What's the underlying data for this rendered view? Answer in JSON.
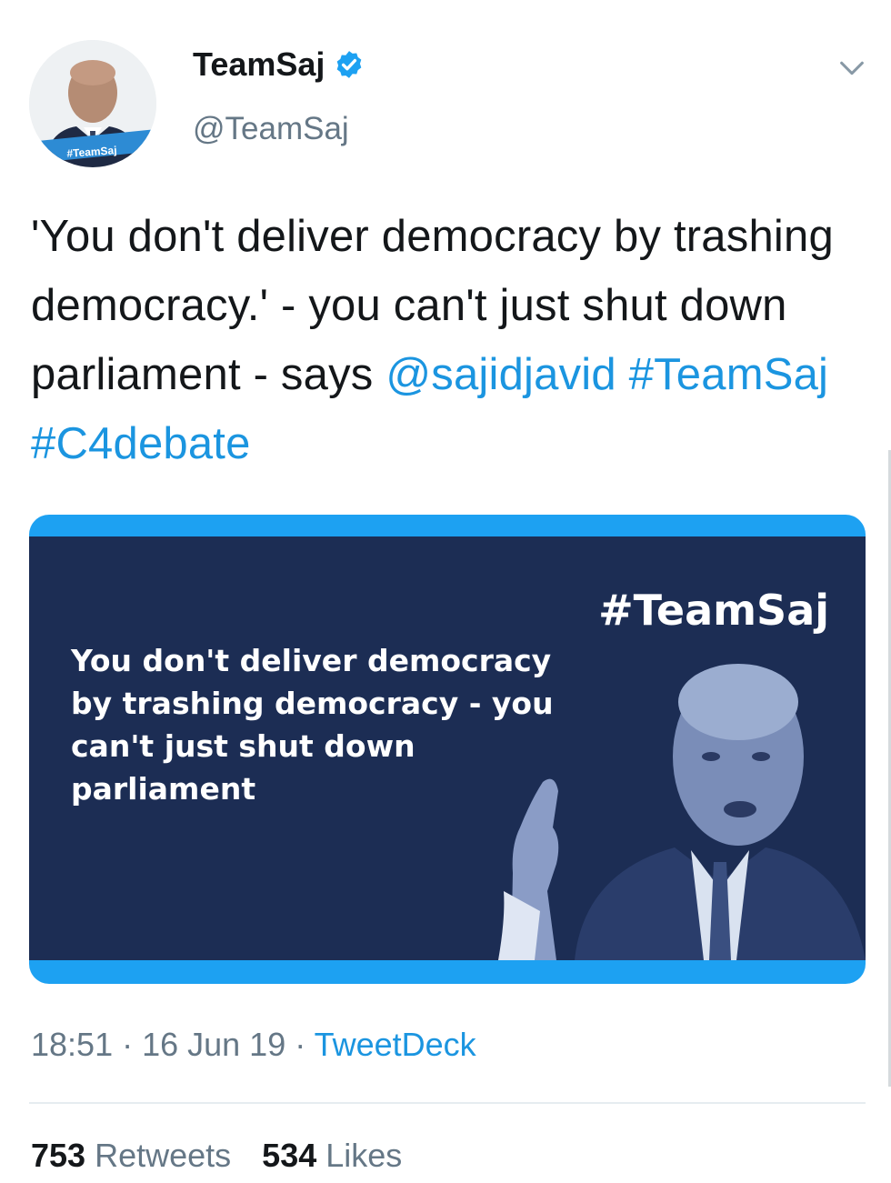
{
  "author": {
    "display_name": "TeamSaj",
    "handle": "@TeamSaj",
    "avatar_tag": "#TeamSaj",
    "verified": true
  },
  "tweet": {
    "text_plain": "'You don't deliver democracy by trashing democracy.' - you can't just shut down parliament - says",
    "mention": "@sajidjavid",
    "hashtag_1": "#TeamSaj",
    "hashtag_2": "#C4debate"
  },
  "media": {
    "hashtag": "#TeamSaj",
    "quote": "You don't deliver democracy by trashing democracy - you can't just shut down parliament"
  },
  "meta": {
    "time": "18:51",
    "separator_1": " · ",
    "date": "16 Jun 19",
    "separator_2": " · ",
    "source": "TweetDeck"
  },
  "stats": {
    "retweets_count": "753",
    "retweets_label": "Retweets",
    "likes_count": "534",
    "likes_label": "Likes"
  },
  "colors": {
    "link": "#1b95e0",
    "media_bg": "#1c2d54",
    "media_accent": "#1da1f2",
    "secondary_text": "#657786"
  },
  "icons": [
    "verified-badge-icon",
    "chevron-down-icon"
  ]
}
